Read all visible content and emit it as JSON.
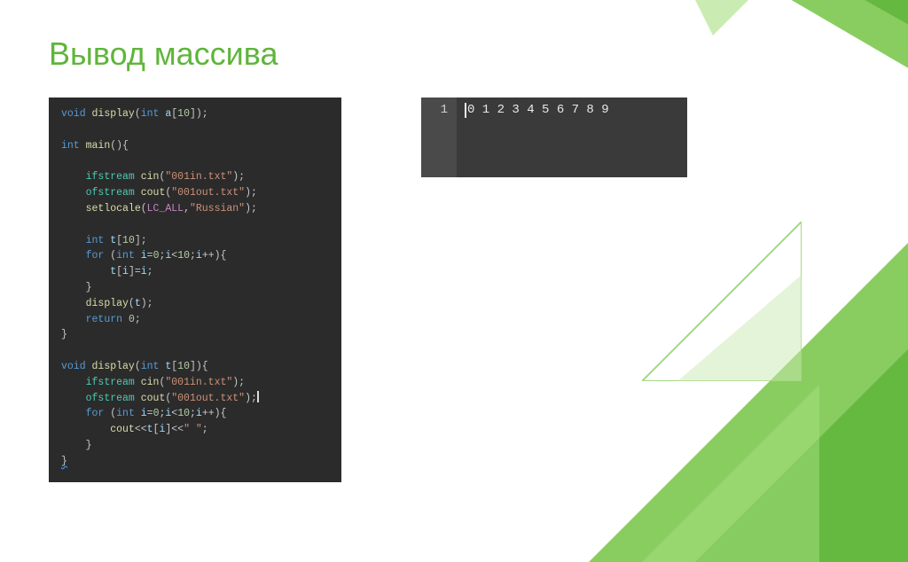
{
  "title": "Вывод массива",
  "output": {
    "line_number": "1",
    "text": "0 1 2 3 4 5 6 7 8 9"
  },
  "code": {
    "l1_kw_void": "void",
    "l1_fn": "display",
    "l1_kw_int": "int",
    "l1_id_a": "a",
    "l1_num_10": "10",
    "l3_kw_int": "int",
    "l3_fn_main": "main",
    "l5_type": "ifstream",
    "l5_fn_cin": "cin",
    "l5_str": "\"001in.txt\"",
    "l6_type": "ofstream",
    "l6_fn_cout": "cout",
    "l6_str": "\"001out.txt\"",
    "l7_fn": "setlocale",
    "l7_const": "LC_ALL",
    "l7_str": "\"Russian\"",
    "l9_kw_int": "int",
    "l9_id_t": "t",
    "l9_num_10": "10",
    "l10_kw_for": "for",
    "l10_kw_int": "int",
    "l10_id_i": "i",
    "l10_num_0": "0",
    "l10_num_10": "10",
    "l10_id_i2": "i",
    "l10_id_i3": "i",
    "l11_id_t": "t",
    "l11_id_i": "i",
    "l11_id_i2": "i",
    "l13_fn_display": "display",
    "l13_id_t": "t",
    "l14_kw_return": "return",
    "l14_num_0": "0",
    "l17_kw_void": "void",
    "l17_fn": "display",
    "l17_kw_int": "int",
    "l17_id_t": "t",
    "l17_num_10": "10",
    "l18_type": "ifstream",
    "l18_fn_cin": "cin",
    "l18_str": "\"001in.txt\"",
    "l19_type": "ofstream",
    "l19_fn_cout": "cout",
    "l19_str": "\"001out.txt\"",
    "l20_kw_for": "for",
    "l20_kw_int": "int",
    "l20_id_i": "i",
    "l20_num_0": "0",
    "l20_num_10": "10",
    "l20_id_i2": "i",
    "l20_id_i3": "i",
    "l21_fn_cout": "cout",
    "l21_id_t": "t",
    "l21_id_i": "i",
    "l21_str_space": "\" \""
  }
}
